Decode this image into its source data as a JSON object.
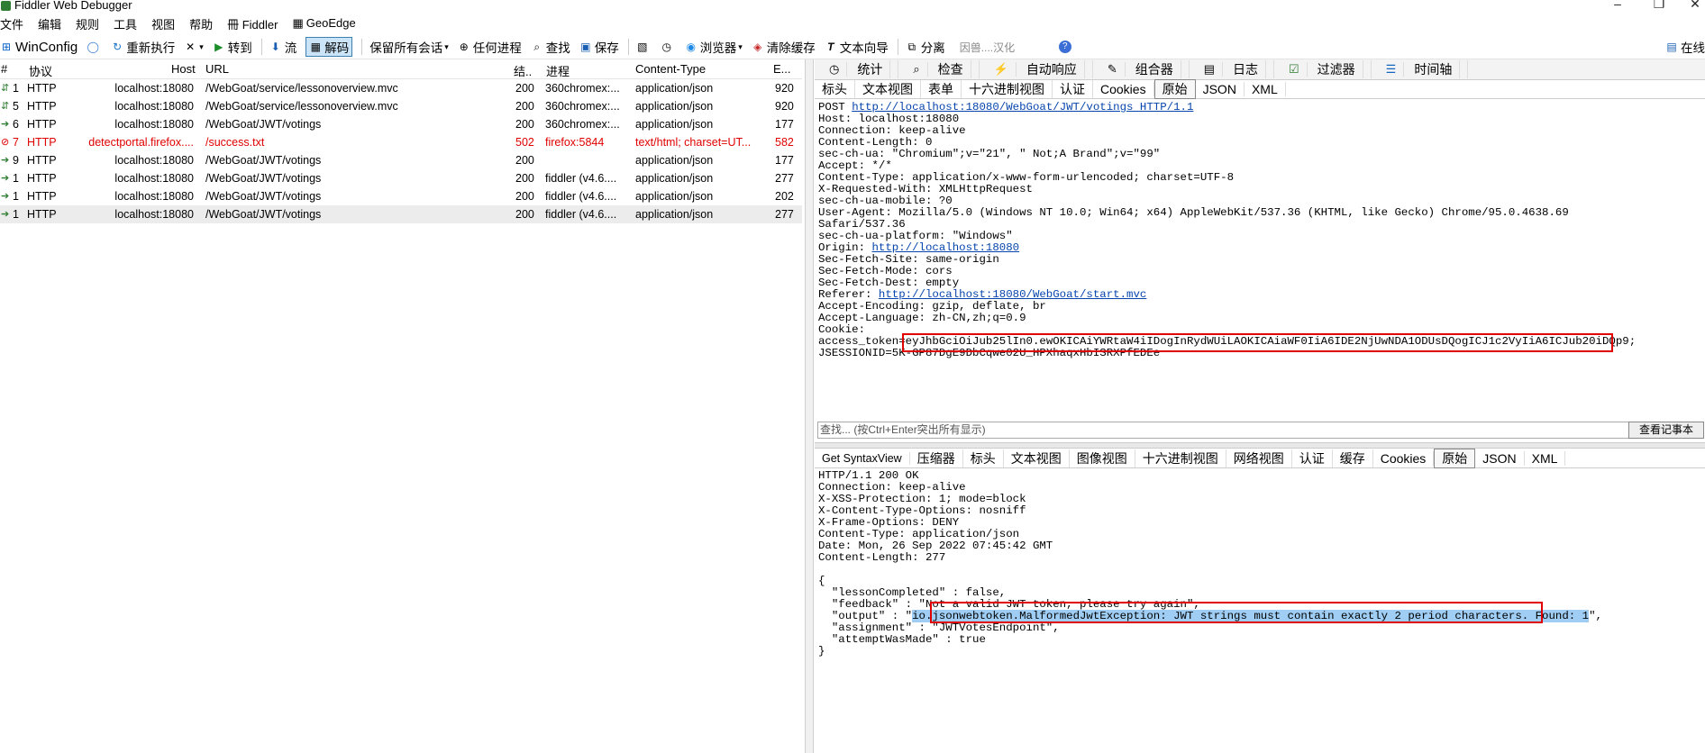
{
  "window": {
    "title": "Fiddler Web Debugger"
  },
  "menu": [
    "文件",
    "编辑",
    "规则",
    "工具",
    "视图",
    "帮助",
    "冊 Fiddler",
    "GeoEdge"
  ],
  "toolbar": {
    "winconfig": "WinConfig",
    "replay": "重新执行",
    "goto": "转到",
    "stream": "流",
    "decode": "解码",
    "keep_sessions": "保留所有会话",
    "any_process": "任何进程",
    "find": "查找",
    "save": "保存",
    "browser": "浏览器",
    "clear_cache": "清除缓存",
    "text_wizard": "文本向导",
    "tearoff": "分离",
    "search_placeholder": "因兽....汉化",
    "online": "在线"
  },
  "grid": {
    "headers": {
      "num": "#",
      "protocol": "协议",
      "host": "Host",
      "url": "URL",
      "result": "结..",
      "process": "进程",
      "ctype": "Content-Type",
      "body": "E..."
    },
    "rows": [
      {
        "num": "1",
        "protocol": "HTTP",
        "host": "localhost:18080",
        "url": "/WebGoat/service/lessonoverview.mvc",
        "result": "200",
        "process": "360chromex:...",
        "ctype": "application/json",
        "body": "920",
        "icon": "⇵",
        "err": false
      },
      {
        "num": "5",
        "protocol": "HTTP",
        "host": "localhost:18080",
        "url": "/WebGoat/service/lessonoverview.mvc",
        "result": "200",
        "process": "360chromex:...",
        "ctype": "application/json",
        "body": "920",
        "icon": "⇵",
        "err": false
      },
      {
        "num": "6",
        "protocol": "HTTP",
        "host": "localhost:18080",
        "url": "/WebGoat/JWT/votings",
        "result": "200",
        "process": "360chromex:...",
        "ctype": "application/json",
        "body": "177",
        "icon": "➔",
        "err": false
      },
      {
        "num": "7",
        "protocol": "HTTP",
        "host": "detectportal.firefox....",
        "url": "/success.txt",
        "result": "502",
        "process": "firefox:5844",
        "ctype": "text/html; charset=UT...",
        "body": "582",
        "icon": "⊘",
        "err": true
      },
      {
        "num": "9",
        "protocol": "HTTP",
        "host": "localhost:18080",
        "url": "/WebGoat/JWT/votings",
        "result": "200",
        "process": "",
        "ctype": "application/json",
        "body": "177",
        "icon": "➔",
        "err": false
      },
      {
        "num": "1",
        "protocol": "HTTP",
        "host": "localhost:18080",
        "url": "/WebGoat/JWT/votings",
        "result": "200",
        "process": "fiddler (v4.6....",
        "ctype": "application/json",
        "body": "277",
        "icon": "➔",
        "err": false
      },
      {
        "num": "1",
        "protocol": "HTTP",
        "host": "localhost:18080",
        "url": "/WebGoat/JWT/votings",
        "result": "200",
        "process": "fiddler (v4.6....",
        "ctype": "application/json",
        "body": "202",
        "icon": "➔",
        "err": false
      },
      {
        "num": "1",
        "protocol": "HTTP",
        "host": "localhost:18080",
        "url": "/WebGoat/JWT/votings",
        "result": "200",
        "process": "fiddler (v4.6....",
        "ctype": "application/json",
        "body": "277",
        "icon": "➔",
        "err": false
      }
    ]
  },
  "toptabs": [
    "统计",
    "检查",
    "自动响应",
    "组合器",
    "日志",
    "过滤器",
    "时间轴"
  ],
  "request": {
    "tabs": [
      "标头",
      "文本视图",
      "表单",
      "十六进制视图",
      "认证",
      "Cookies",
      "原始",
      "JSON",
      "XML"
    ],
    "line1_pre": "POST ",
    "line1_url": "http://localhost:18080/WebGoat/JWT/votings HTTP/1.1",
    "lines_a": "Host: localhost:18080\nConnection: keep-alive\nContent-Length: 0\nsec-ch-ua: \"Chromium\";v=\"21\", \" Not;A Brand\";v=\"99\"\nAccept: */*\nContent-Type: application/x-www-form-urlencoded; charset=UTF-8\nX-Requested-With: XMLHttpRequest\nsec-ch-ua-mobile: ?0\nUser-Agent: Mozilla/5.0 (Windows NT 10.0; Win64; x64) AppleWebKit/537.36 (KHTML, like Gecko) Chrome/95.0.4638.69\nSafari/537.36\nsec-ch-ua-platform: \"Windows\"",
    "origin_label": "Origin: ",
    "origin_url": "http://localhost:18080",
    "lines_b": "Sec-Fetch-Site: same-origin\nSec-Fetch-Mode: cors\nSec-Fetch-Dest: empty",
    "referer_label": "Referer: ",
    "referer_url": "http://localhost:18080/WebGoat/start.mvc",
    "lines_c": "Accept-Encoding: gzip, deflate, br\nAccept-Language: zh-CN,zh;q=0.9\nCookie:",
    "token_label": "access_token",
    "token_value": "=eyJhbGciOiJub25lIn0.ewOKICAiYWRtaW4iIDogInRydWUiLAOKICAiaWF0IiA6IDE2NjUwNDA1ODUsDQogICJ1c2VyIiA6ICJub20iDQp9;",
    "session_line": "JSESSIONID=5K-GP87DgE9DbCqwe02U_HPXhaqxHbISRXPfEDEe",
    "find_placeholder": "查找... (按Ctrl+Enter突出所有显示)",
    "find_button": "查看记事本"
  },
  "response": {
    "tabs": [
      "Get SyntaxView",
      "压缩器",
      "标头",
      "文本视图",
      "图像视图",
      "十六进制视图",
      "网络视图",
      "认证",
      "缓存",
      "Cookies",
      "原始",
      "JSON",
      "XML"
    ],
    "headers": "HTTP/1.1 200 OK\nConnection: keep-alive\nX-XSS-Protection: 1; mode=block\nX-Content-Type-Options: nosniff\nX-Frame-Options: DENY\nContent-Type: application/json\nDate: Mon, 26 Sep 2022 07:45:42 GMT\nContent-Length: 277",
    "body_a": "{\n  \"lessonCompleted\" : false,\n  \"feedback\" : \"Not a valid JWT token, please try again\",",
    "output_pre": "  \"output\" : \"",
    "output_hl": "io.jsonwebtoken.MalformedJwtException: JWT strings must contain exactly 2 period characters. Found: 1",
    "output_post": "\",",
    "body_b": "  \"assignment\" : \"JWTVotesEndpoint\",\n  \"attemptWasMade\" : true\n}"
  }
}
